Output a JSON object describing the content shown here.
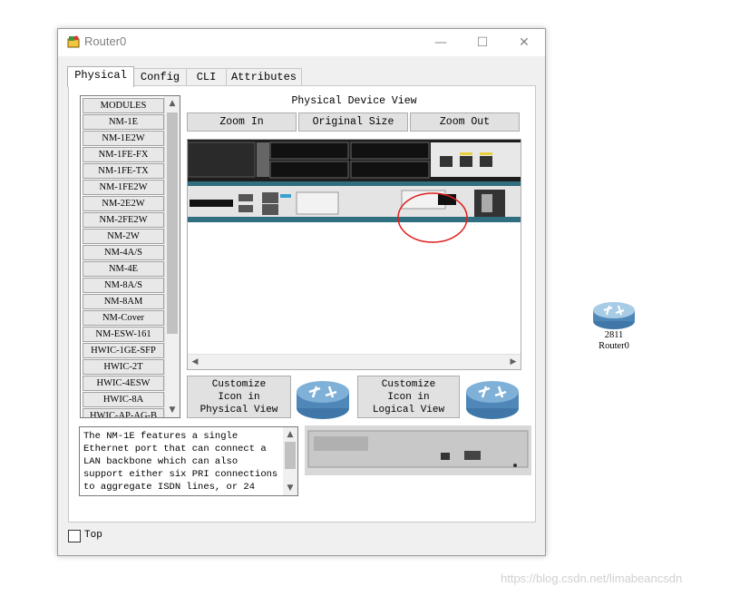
{
  "window": {
    "title": "Router0",
    "minimize": "—",
    "maximize": "☐",
    "close": "✕"
  },
  "tabs": [
    {
      "label": "Physical"
    },
    {
      "label": "Config"
    },
    {
      "label": "CLI"
    },
    {
      "label": "Attributes"
    }
  ],
  "modules": {
    "header": "MODULES",
    "items": [
      "NM-1E",
      "NM-1E2W",
      "NM-1FE-FX",
      "NM-1FE-TX",
      "NM-1FE2W",
      "NM-2E2W",
      "NM-2FE2W",
      "NM-2W",
      "NM-4A/S",
      "NM-4E",
      "NM-8A/S",
      "NM-8AM",
      "NM-Cover",
      "NM-ESW-161",
      "HWIC-1GE-SFP",
      "HWIC-2T",
      "HWIC-4ESW",
      "HWIC-8A",
      "HWIC-AP-AG-B"
    ]
  },
  "physical_view": {
    "label": "Physical Device View",
    "zoom_in": "Zoom In",
    "original_size": "Original Size",
    "zoom_out": "Zoom Out"
  },
  "customize": {
    "physical": "Customize\nIcon in\nPhysical View",
    "logical": "Customize\nIcon in\nLogical View"
  },
  "description": "The NM-1E features a single Ethernet port that can connect a LAN backbone which can also support either six PRI connections to aggregate ISDN lines, or 24",
  "top_checkbox": {
    "label": "Top",
    "checked": false
  },
  "workspace_node": {
    "model": "2811",
    "name": "Router0"
  },
  "watermark": "https://blog.csdn.net/limabeancsdn",
  "colors": {
    "router_blue": "#5a8fb8",
    "annotation_red": "#e02020",
    "device_teal": "#2f6f7f"
  }
}
